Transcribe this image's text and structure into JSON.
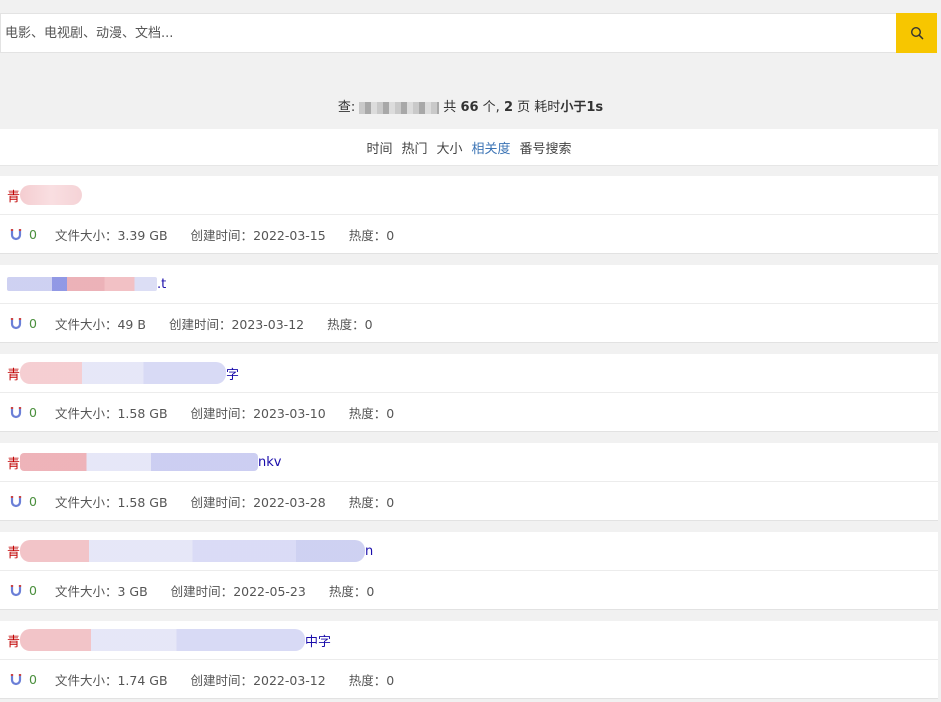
{
  "search": {
    "placeholder": "电影、电视剧、动漫、文档..."
  },
  "summary": {
    "prefix": "查:",
    "middle": "共",
    "count": "66",
    "count_unit": "个,",
    "pages": "2",
    "pages_unit": "页",
    "time_label": "耗时",
    "time_value": "小于1s"
  },
  "sort_tabs": [
    {
      "label": "时间"
    },
    {
      "label": "热门"
    },
    {
      "label": "大小"
    },
    {
      "label": "相关度"
    },
    {
      "label": "番号搜索"
    }
  ],
  "labels": {
    "size": "文件大小：",
    "created": "创建时间：",
    "heat": "热度："
  },
  "results": [
    {
      "title_prefix": "青",
      "title_suffix": "",
      "magnet": "0",
      "size": "3.39 GB",
      "created": "2022-03-15",
      "heat": "0"
    },
    {
      "title_prefix": "",
      "title_suffix": ".t",
      "magnet": "0",
      "size": "49 B",
      "created": "2023-03-12",
      "heat": "0"
    },
    {
      "title_prefix": "青",
      "title_suffix": "字",
      "magnet": "0",
      "size": "1.58 GB",
      "created": "2023-03-10",
      "heat": "0"
    },
    {
      "title_prefix": "青",
      "title_suffix": "nkv",
      "magnet": "0",
      "size": "1.58 GB",
      "created": "2022-03-28",
      "heat": "0"
    },
    {
      "title_prefix": "青",
      "title_suffix": "n",
      "magnet": "0",
      "size": "3 GB",
      "created": "2022-05-23",
      "heat": "0"
    },
    {
      "title_prefix": "青",
      "title_suffix": "中字",
      "magnet": "0",
      "size": "1.74 GB",
      "created": "2022-03-12",
      "heat": "0"
    }
  ],
  "colors": {
    "accent": "#f7c600",
    "link": "#1a0dab",
    "active_sort": "#3c74b5"
  }
}
